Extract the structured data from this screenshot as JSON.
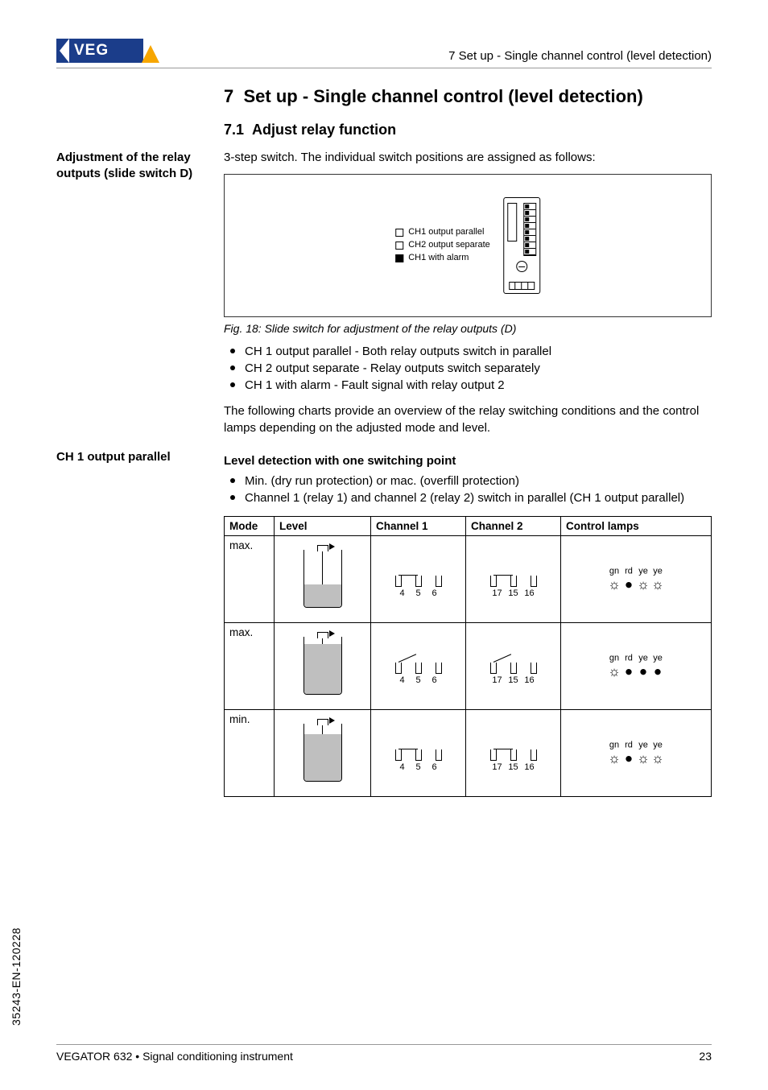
{
  "header": {
    "section_label": "7  Set up - Single channel control (level detection)"
  },
  "chapter": {
    "num": "7",
    "title": "Set up - Single channel control (level detection)"
  },
  "section": {
    "num": "7.1",
    "title": "Adjust relay function"
  },
  "side": {
    "adjustment": "Adjustment of the relay outputs (slide switch D)",
    "ch1parallel": "CH 1 output parallel"
  },
  "intro": "3-step switch. The individual switch positions are assigned as follows:",
  "switch_legend": {
    "a": "CH1 output parallel",
    "b": "CH2 output separate",
    "c": "CH1 with alarm"
  },
  "figcaption": "Fig. 18: Slide switch for adjustment of the relay outputs (D)",
  "bullets1": {
    "a": "CH 1 output parallel - Both relay outputs switch in parallel",
    "b": "CH 2 output separate - Relay outputs switch separately",
    "c": "CH 1 with alarm - Fault signal with relay output 2"
  },
  "para2": "The following charts provide an overview of the relay switching conditions and the control lamps depending on the adjusted mode and level.",
  "subhead": "Level detection with one switching point",
  "bullets2": {
    "a": "Min. (dry run protection) or mac. (overfill protection)",
    "b": "Channel 1 (relay 1) and channel 2 (relay 2) switch in parallel (CH 1 output parallel)"
  },
  "table": {
    "headers": {
      "mode": "Mode",
      "level": "Level",
      "ch1": "Channel 1",
      "ch2": "Channel 2",
      "lamps": "Control lamps"
    },
    "lamp_labels": {
      "gn": "gn",
      "rd": "rd",
      "ye1": "ye",
      "ye2": "ye"
    },
    "ch1_terms": {
      "a": "4",
      "b": "5",
      "c": "6"
    },
    "ch2_terms": {
      "a": "17",
      "b": "15",
      "c": "16"
    },
    "rows": [
      {
        "mode": "max.",
        "fill": 28,
        "rod": 42,
        "relay": "closed",
        "lamps": [
          "on",
          "off",
          "on",
          "on"
        ]
      },
      {
        "mode": "max.",
        "fill": 62,
        "rod": 42,
        "relay": "open",
        "lamps": [
          "on",
          "off",
          "off",
          "off"
        ]
      },
      {
        "mode": "min.",
        "fill": 58,
        "rod": 58,
        "relay": "closed",
        "lamps": [
          "on",
          "off",
          "on",
          "on"
        ]
      }
    ]
  },
  "footer": {
    "left": "VEGATOR 632 • Signal conditioning instrument",
    "page": "23",
    "sidecode": "35243-EN-120228"
  }
}
